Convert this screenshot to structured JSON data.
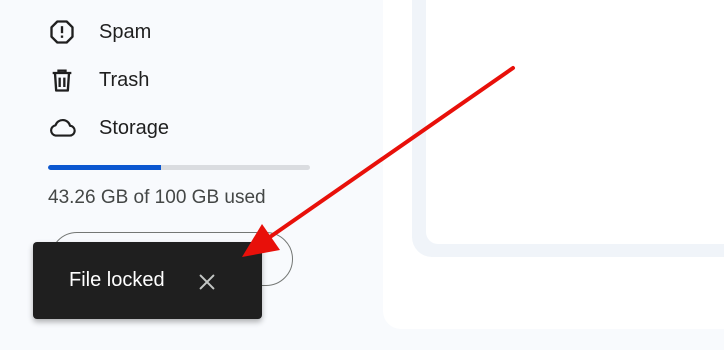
{
  "sidebar": {
    "items": [
      {
        "label": "Spam",
        "icon": "spam-icon"
      },
      {
        "label": "Trash",
        "icon": "trash-icon"
      },
      {
        "label": "Storage",
        "icon": "cloud-icon"
      }
    ],
    "storage": {
      "used_text": "43.26 GB of 100 GB used",
      "used_fraction": 0.4326,
      "bar_color": "#0b57d0",
      "track_color": "#dadce0"
    }
  },
  "snackbar": {
    "message": "File locked",
    "close_icon": "close-icon"
  },
  "annotation": {
    "arrow_color": "#e8100a"
  }
}
